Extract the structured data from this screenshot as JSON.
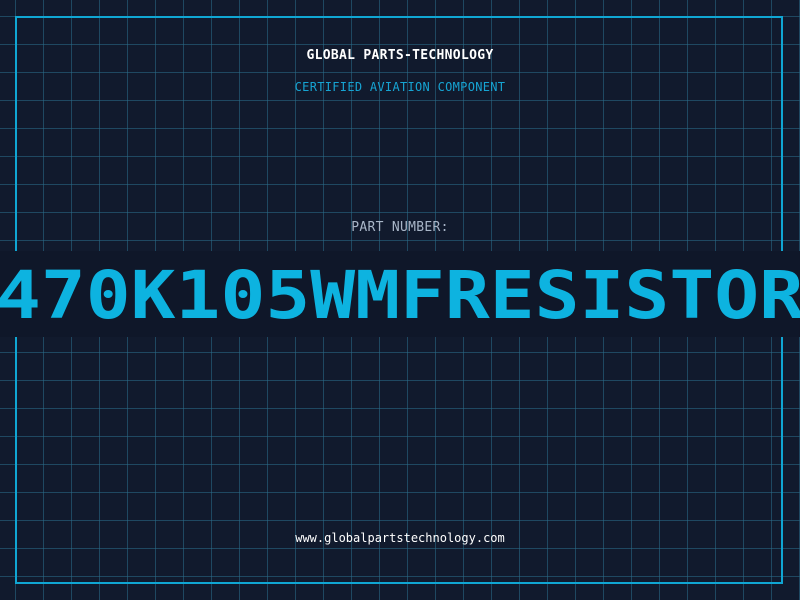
{
  "brand": {
    "name": "GLOBAL PARTS-TECHNOLOGY",
    "tagline": "CERTIFIED AVIATION COMPONENT"
  },
  "part": {
    "label": "PART NUMBER:",
    "number": "470K105WMFRESISTOR"
  },
  "footer": {
    "website": "www.globalpartstechnology.com"
  },
  "colors": {
    "background": "#111a2d",
    "grid": "#2a6e8c",
    "accent": "#10a6d3",
    "part_number": "#0db3e0"
  }
}
